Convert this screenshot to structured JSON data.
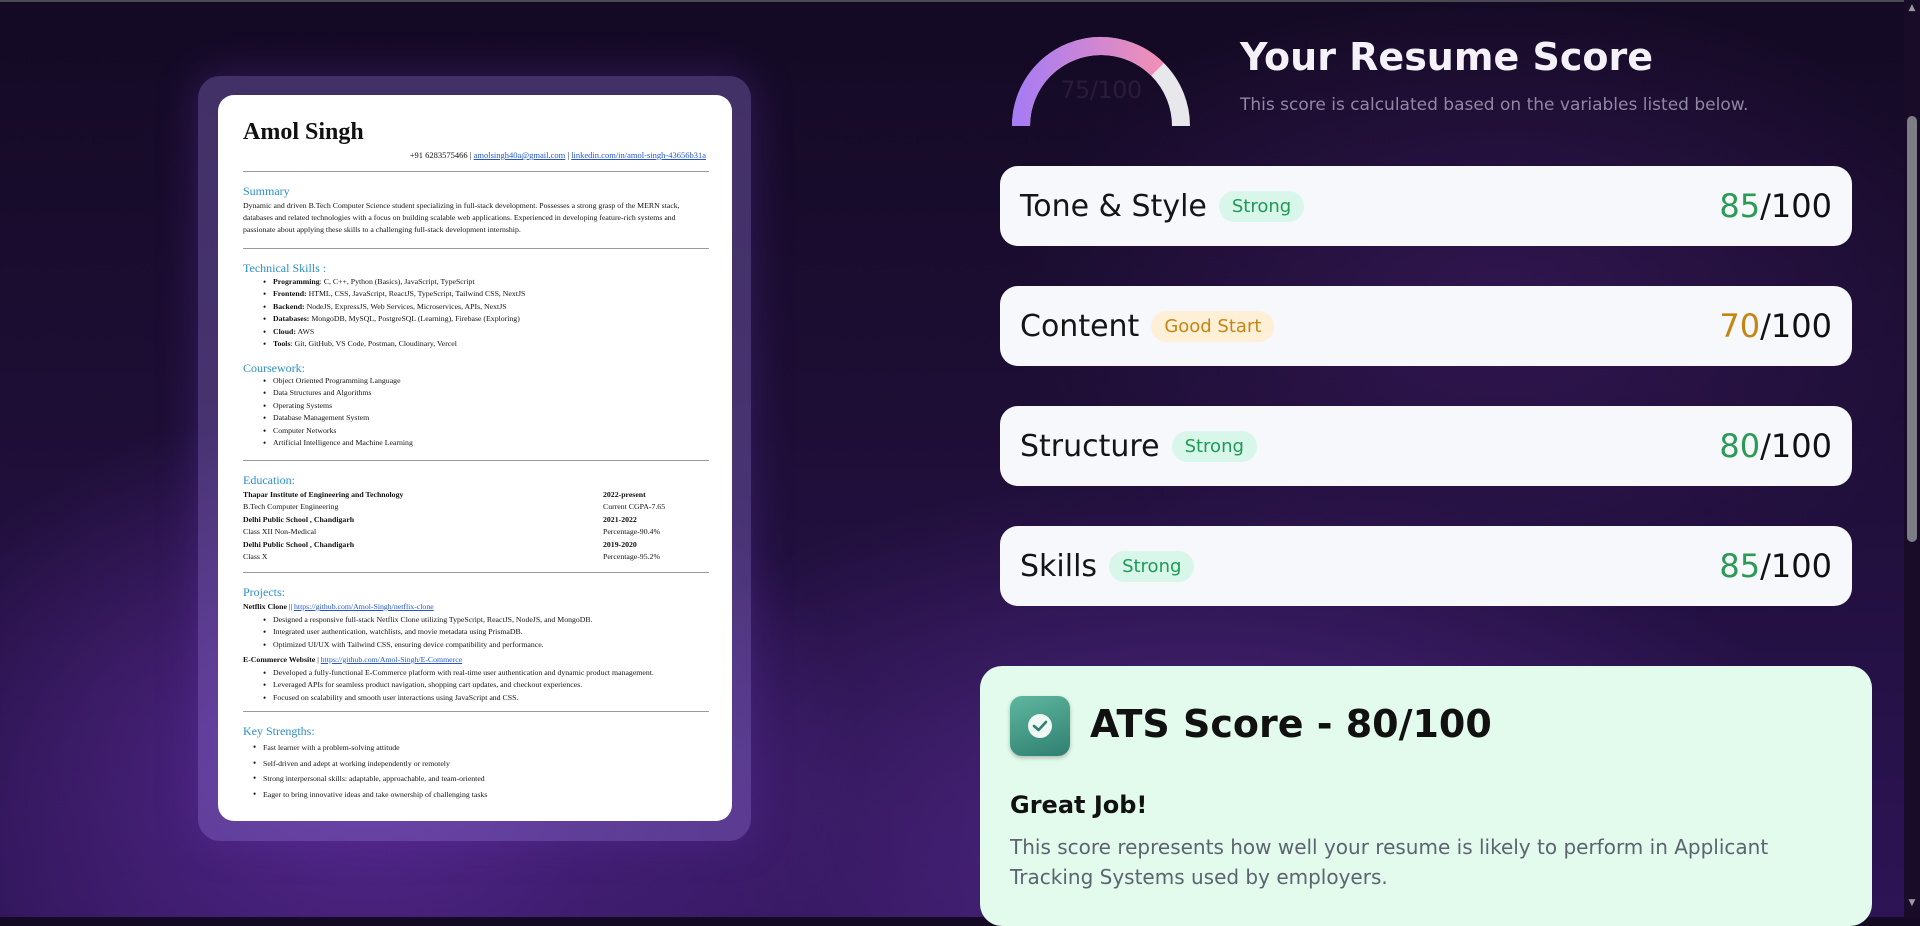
{
  "resume": {
    "name": "Amol Singh",
    "contact_phone": "+91 6283575466 | ",
    "contact_email": "amolsingh40a@gmail.com",
    "contact_sep": " | ",
    "contact_linkedin": "linkedin.com/in/amol-singh-43656b31a",
    "summary_title": "Summary",
    "summary_text": "Dynamic and driven B.Tech Computer Science student specializing in full-stack development. Possesses a strong grasp of the MERN stack, databases and related technologies with a focus on building scalable web applications. Experienced in developing feature-rich systems and passionate about applying these skills to a challenging full-stack development internship.",
    "skills_title": "Technical Skills :",
    "skills": [
      {
        "label": "Programming",
        "value": ": C, C++, Python (Basics), JavaScript, TypeScript"
      },
      {
        "label": "Frontend:",
        "value": " HTML, CSS, JavaScript, ReactJS, TypeScript, Tailwind CSS, NextJS"
      },
      {
        "label": "Backend:",
        "value": " NodeJS, ExpressJS, Web Services, Microservices, APIs, NextJS"
      },
      {
        "label": "Databases:",
        "value": " MongoDB, MySQL, PostgreSQL (Learning), Firebase (Exploring)"
      },
      {
        "label": "Cloud:",
        "value": " AWS"
      },
      {
        "label": "Tools",
        "value": ": Git, GitHub, VS Code, Postman, Cloudinary, Vercel"
      }
    ],
    "coursework_title": "Coursework:",
    "coursework": [
      "Object Oriented Programming Language",
      "Data Structures and Algorithms",
      "Operating Systems",
      "Database Management System",
      "Computer Networks",
      "Artificial Intelligence and Machine Learning"
    ],
    "education_title": "Education:",
    "education": [
      {
        "left": "Thapar Institute of Engineering and Technology",
        "right": "2022-present",
        "bold": true
      },
      {
        "left": "B.Tech Computer Engineering",
        "right": "Current CGPA-7.65",
        "bold": false
      },
      {
        "left": "Delhi Public School , Chandigarh",
        "right": "2021-2022",
        "bold": true
      },
      {
        "left": "Class XII Non-Medical",
        "right": "Percentage-90.4%",
        "bold": false
      },
      {
        "left": "Delhi Public School , Chandigarh",
        "right": "2019-2020",
        "bold": true
      },
      {
        "left": "Class X",
        "right": "Percentage-95.2%",
        "bold": false
      }
    ],
    "projects_title": "Projects:",
    "project1_name": "Netflix Clone",
    "project1_sep": " || ",
    "project1_link": "https://github.com/Amol-Singh/netflix-clone",
    "project1_points": [
      "Designed a responsive full-stack Netflix Clone utilizing TypeScript, ReactJS, NodeJS, and MongoDB.",
      "Integrated user authentication, watchlists, and movie metadata using PrismaDB.",
      "Optimized UI/UX with Tailwind CSS, ensuring device compatibility and performance."
    ],
    "project2_name": "E-Commerce Website",
    "project2_sep": " | ",
    "project2_link": "https://github.com/Amol-Singh/E-Commerce",
    "project2_points": [
      "Developed a fully-functional E-Commerce platform with real-time user authentication and dynamic product management.",
      "Leveraged APIs for seamless product navigation, shopping cart updates, and checkout experiences.",
      "Focused on scalability and smooth user interactions using JavaScript and CSS."
    ],
    "strengths_title": "Key Strengths:",
    "strengths": [
      "Fast learner with a problem-solving attitude",
      "Self-driven and adept at working independently or remotely",
      "Strong interpersonal skills: adaptable, approachable, and team-oriented",
      "Eager to bring innovative ideas and take ownership of challenging tasks"
    ]
  },
  "score_header": {
    "gauge_text": "75/100",
    "gauge_value": 0.75,
    "title": "Your Resume Score",
    "subtitle": "This score is calculated based on the variables listed below."
  },
  "categories": [
    {
      "name": "Tone & Style",
      "badge": "Strong",
      "score": "85",
      "max": "/100"
    },
    {
      "name": "Content",
      "badge": "Good Start",
      "score": "70",
      "max": "/100"
    },
    {
      "name": "Structure",
      "badge": "Strong",
      "score": "80",
      "max": "/100"
    },
    {
      "name": "Skills",
      "badge": "Strong",
      "score": "85",
      "max": "/100"
    }
  ],
  "ats": {
    "icon": "check-badge-icon",
    "title": "ATS Score - 80/100",
    "subtitle": "Great Job!",
    "description": "This score represents how well your resume is likely to perform in Applicant Tracking Systems used by employers."
  },
  "colors": {
    "strong": "#2b9a54",
    "good_start": "#c48515",
    "ats_card": "#e2fbec"
  }
}
